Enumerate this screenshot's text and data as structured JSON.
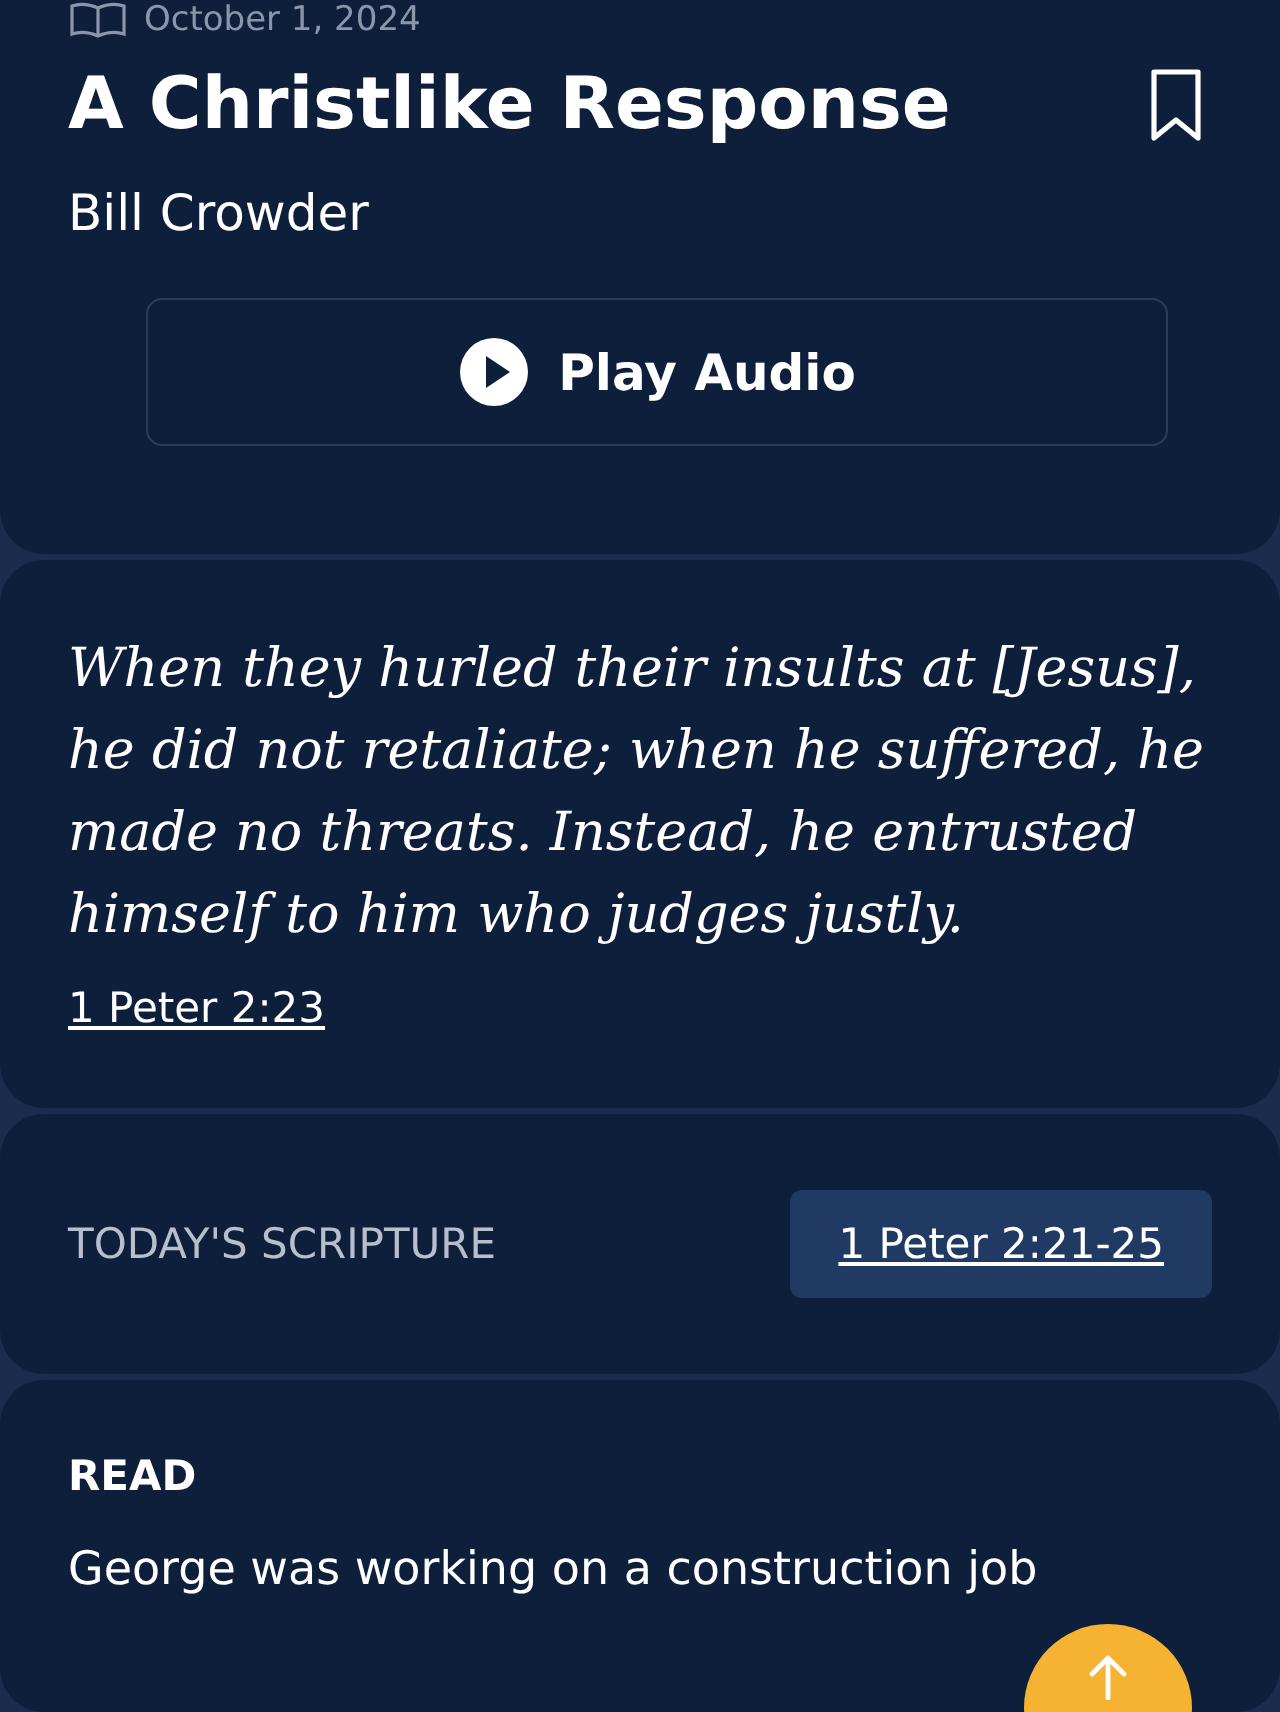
{
  "devotional": {
    "date": "October 1, 2024",
    "title": "A Christlike Response",
    "author": "Bill Crowder",
    "bookmarked": false,
    "play_button": "Play Audio"
  },
  "verse": {
    "text": "When they hurled their insults at [Jesus], he did not retaliate; when he suffered, he made no threats. Instead, he entrusted himself to him who judges justly.",
    "reference": "1 Peter 2:23"
  },
  "scripture": {
    "label": "TODAY'S SCRIPTURE",
    "reference": "1 Peter 2:21-25"
  },
  "read": {
    "heading": "READ",
    "text": "George was working on a construction job"
  }
}
